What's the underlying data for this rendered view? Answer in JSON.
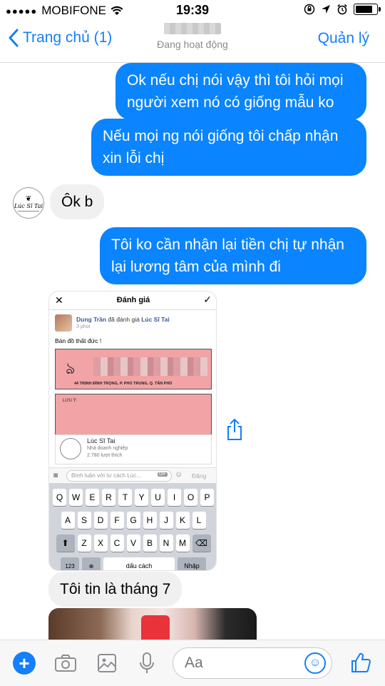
{
  "status": {
    "carrier": "MOBIFONE",
    "time": "19:39"
  },
  "nav": {
    "back_label": "Trang chủ (1)",
    "subtitle": "Đang hoạt động",
    "manage_label": "Quản lý"
  },
  "messages": [
    {
      "from": "me",
      "text": "Ok nếu chị nói vậy thì tôi hỏi mọi người xem nó có giống mẫu ko"
    },
    {
      "from": "me",
      "text": "Nếu mọi ng nói giống tôi chấp nhận xin lỗi chị"
    },
    {
      "from": "them",
      "text": "Ôk b"
    },
    {
      "from": "me",
      "text": "Tôi ko cần nhận lại tiền chị tự nhận lại lương tâm của mình đi"
    },
    {
      "from": "them",
      "text": "Tôi tin là tháng 7"
    }
  ],
  "avatar_text": "Lúc Sĩ Tai",
  "embedded_screenshot": {
    "header_title": "Đánh giá",
    "post_author": "Dung Trần",
    "post_action": " đã đánh giá ",
    "post_page": "Lúc Sĩ Tai",
    "post_time": "3 phút",
    "post_text": "Bán đồ thất đức !",
    "address_line": "44 TRỊNH ĐÌNH TRỌNG, P. PHÚ TRUNG, Q. TÂN PHÚ",
    "phone_line": "0909 523 008 - 0121 322 7732 (HÂN)",
    "luu_y_label": "LƯU Ý:",
    "page_name": "Lúc Sĩ Tai",
    "page_category": "Nhà doanh nghiệp",
    "page_likes": "2.780 lượt thích",
    "comment_placeholder": "Bình luận với tư cách Lúc...",
    "send_label": "Đăng",
    "keyboard_row1": [
      "Q",
      "W",
      "E",
      "R",
      "T",
      "Y",
      "U",
      "I",
      "O",
      "P"
    ],
    "keyboard_row2": [
      "A",
      "S",
      "D",
      "F",
      "G",
      "H",
      "J",
      "K",
      "L"
    ],
    "keyboard_row3": [
      "Z",
      "X",
      "C",
      "V",
      "B",
      "N",
      "M"
    ],
    "numbers_key": "123",
    "space_key": "dấu cách",
    "return_key": "Nhập"
  },
  "composer": {
    "placeholder": "Aa"
  },
  "colors": {
    "accent": "#147efb",
    "outgoing_bubble": "#0a84ff",
    "incoming_bubble": "#f1f0f0"
  },
  "battery_level": 0.9
}
